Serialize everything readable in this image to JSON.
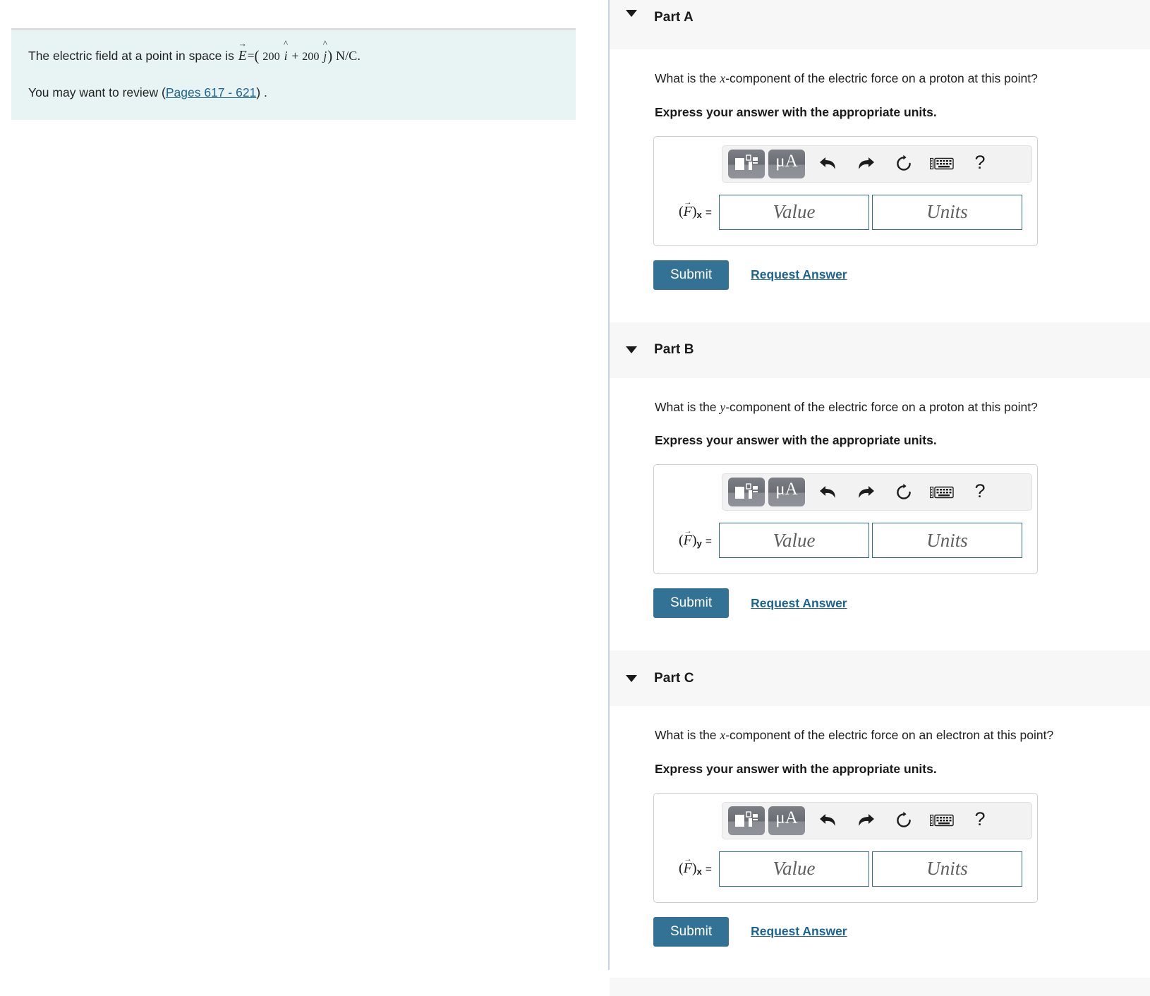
{
  "left_panel": {
    "problem_statement": {
      "lead": "The electric field at a point in space is",
      "field_symbol": "E",
      "open_paren": "(",
      "coef_i": "200",
      "unit_i": "i",
      "plus": "+",
      "coef_j": "200",
      "unit_j": "j",
      "close_paren": ")",
      "units": "N/C",
      "period": "."
    },
    "review_line": {
      "prefix": "You may want to review (",
      "link_text": "Pages 617 - 621",
      "suffix": ") ."
    }
  },
  "parts": [
    {
      "id": "part-a",
      "title": "Part A",
      "question_prefix": "What is the ",
      "question_var": "x",
      "question_suffix": "-component of the electric force on a proton at this point?",
      "instruction": "Express your answer with the appropriate units.",
      "answer": {
        "label_symbol": "F",
        "label_subscript": "x",
        "label_equals": "=",
        "value_placeholder": "Value",
        "units_placeholder": "Units",
        "value_current": "",
        "units_current": ""
      },
      "toolbar": {
        "template_icon": "math-template-icon",
        "units_icon_label": "μA",
        "undo_icon": "undo-icon",
        "redo_icon": "redo-icon",
        "reset_icon": "reset-icon",
        "keyboard_icon": "keyboard-icon",
        "help_label": "?"
      },
      "submit_label": "Submit",
      "request_label": "Request Answer"
    },
    {
      "id": "part-b",
      "title": "Part B",
      "question_prefix": "What is the ",
      "question_var": "y",
      "question_suffix": "-component of the electric force on a proton at this point?",
      "instruction": "Express your answer with the appropriate units.",
      "answer": {
        "label_symbol": "F",
        "label_subscript": "y",
        "label_equals": "=",
        "value_placeholder": "Value",
        "units_placeholder": "Units",
        "value_current": "",
        "units_current": ""
      },
      "toolbar": {
        "template_icon": "math-template-icon",
        "units_icon_label": "μA",
        "undo_icon": "undo-icon",
        "redo_icon": "redo-icon",
        "reset_icon": "reset-icon",
        "keyboard_icon": "keyboard-icon",
        "help_label": "?"
      },
      "submit_label": "Submit",
      "request_label": "Request Answer"
    },
    {
      "id": "part-c",
      "title": "Part C",
      "question_prefix": "What is the ",
      "question_var": "x",
      "question_suffix": "-component of the electric force on an electron at this point?",
      "instruction": "Express your answer with the appropriate units.",
      "answer": {
        "label_symbol": "F",
        "label_subscript": "x",
        "label_equals": "=",
        "value_placeholder": "Value",
        "units_placeholder": "Units",
        "value_current": "",
        "units_current": ""
      },
      "toolbar": {
        "template_icon": "math-template-icon",
        "units_icon_label": "μA",
        "undo_icon": "undo-icon",
        "redo_icon": "redo-icon",
        "reset_icon": "reset-icon",
        "keyboard_icon": "keyboard-icon",
        "help_label": "?"
      },
      "submit_label": "Submit",
      "request_label": "Request Answer"
    }
  ],
  "colors": {
    "accent_button": "#337294",
    "link": "#1a6496",
    "input_border": "#2d6c8e",
    "problem_bg": "#e8f4f3",
    "part_header_bg": "#f7f7f7"
  }
}
